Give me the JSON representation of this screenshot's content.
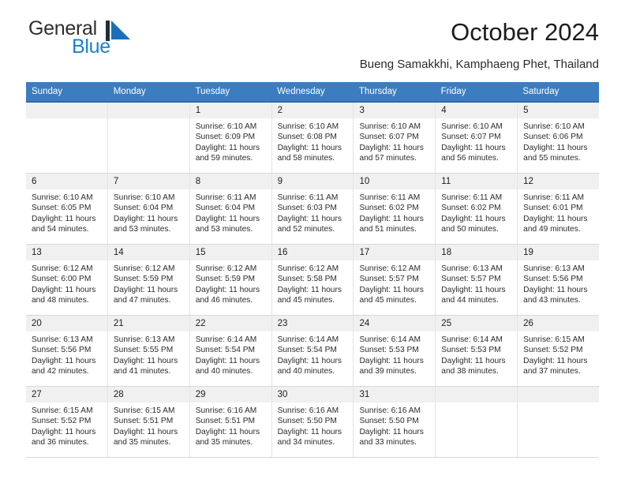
{
  "brand": {
    "name_dark": "General",
    "name_blue": "Blue",
    "mark": "triangle-logo",
    "color_dark": "#2e2e2e",
    "color_blue": "#1b80d4"
  },
  "header": {
    "title": "October 2024",
    "subtitle": "Bueng Samakkhi, Kamphaeng Phet, Thailand"
  },
  "theme": {
    "header_bg": "#3b7dc0",
    "header_text": "#ffffff",
    "daynum_bg": "#f0f0f0",
    "cell_bg": "#ffffff",
    "grid_line": "#e4e4e4"
  },
  "weekdays": [
    "Sunday",
    "Monday",
    "Tuesday",
    "Wednesday",
    "Thursday",
    "Friday",
    "Saturday"
  ],
  "weeks": [
    [
      {
        "date": "",
        "lines": []
      },
      {
        "date": "",
        "lines": []
      },
      {
        "date": "1",
        "lines": [
          "Sunrise: 6:10 AM",
          "Sunset: 6:09 PM",
          "Daylight: 11 hours",
          "and 59 minutes."
        ]
      },
      {
        "date": "2",
        "lines": [
          "Sunrise: 6:10 AM",
          "Sunset: 6:08 PM",
          "Daylight: 11 hours",
          "and 58 minutes."
        ]
      },
      {
        "date": "3",
        "lines": [
          "Sunrise: 6:10 AM",
          "Sunset: 6:07 PM",
          "Daylight: 11 hours",
          "and 57 minutes."
        ]
      },
      {
        "date": "4",
        "lines": [
          "Sunrise: 6:10 AM",
          "Sunset: 6:07 PM",
          "Daylight: 11 hours",
          "and 56 minutes."
        ]
      },
      {
        "date": "5",
        "lines": [
          "Sunrise: 6:10 AM",
          "Sunset: 6:06 PM",
          "Daylight: 11 hours",
          "and 55 minutes."
        ]
      }
    ],
    [
      {
        "date": "6",
        "lines": [
          "Sunrise: 6:10 AM",
          "Sunset: 6:05 PM",
          "Daylight: 11 hours",
          "and 54 minutes."
        ]
      },
      {
        "date": "7",
        "lines": [
          "Sunrise: 6:10 AM",
          "Sunset: 6:04 PM",
          "Daylight: 11 hours",
          "and 53 minutes."
        ]
      },
      {
        "date": "8",
        "lines": [
          "Sunrise: 6:11 AM",
          "Sunset: 6:04 PM",
          "Daylight: 11 hours",
          "and 53 minutes."
        ]
      },
      {
        "date": "9",
        "lines": [
          "Sunrise: 6:11 AM",
          "Sunset: 6:03 PM",
          "Daylight: 11 hours",
          "and 52 minutes."
        ]
      },
      {
        "date": "10",
        "lines": [
          "Sunrise: 6:11 AM",
          "Sunset: 6:02 PM",
          "Daylight: 11 hours",
          "and 51 minutes."
        ]
      },
      {
        "date": "11",
        "lines": [
          "Sunrise: 6:11 AM",
          "Sunset: 6:02 PM",
          "Daylight: 11 hours",
          "and 50 minutes."
        ]
      },
      {
        "date": "12",
        "lines": [
          "Sunrise: 6:11 AM",
          "Sunset: 6:01 PM",
          "Daylight: 11 hours",
          "and 49 minutes."
        ]
      }
    ],
    [
      {
        "date": "13",
        "lines": [
          "Sunrise: 6:12 AM",
          "Sunset: 6:00 PM",
          "Daylight: 11 hours",
          "and 48 minutes."
        ]
      },
      {
        "date": "14",
        "lines": [
          "Sunrise: 6:12 AM",
          "Sunset: 5:59 PM",
          "Daylight: 11 hours",
          "and 47 minutes."
        ]
      },
      {
        "date": "15",
        "lines": [
          "Sunrise: 6:12 AM",
          "Sunset: 5:59 PM",
          "Daylight: 11 hours",
          "and 46 minutes."
        ]
      },
      {
        "date": "16",
        "lines": [
          "Sunrise: 6:12 AM",
          "Sunset: 5:58 PM",
          "Daylight: 11 hours",
          "and 45 minutes."
        ]
      },
      {
        "date": "17",
        "lines": [
          "Sunrise: 6:12 AM",
          "Sunset: 5:57 PM",
          "Daylight: 11 hours",
          "and 45 minutes."
        ]
      },
      {
        "date": "18",
        "lines": [
          "Sunrise: 6:13 AM",
          "Sunset: 5:57 PM",
          "Daylight: 11 hours",
          "and 44 minutes."
        ]
      },
      {
        "date": "19",
        "lines": [
          "Sunrise: 6:13 AM",
          "Sunset: 5:56 PM",
          "Daylight: 11 hours",
          "and 43 minutes."
        ]
      }
    ],
    [
      {
        "date": "20",
        "lines": [
          "Sunrise: 6:13 AM",
          "Sunset: 5:56 PM",
          "Daylight: 11 hours",
          "and 42 minutes."
        ]
      },
      {
        "date": "21",
        "lines": [
          "Sunrise: 6:13 AM",
          "Sunset: 5:55 PM",
          "Daylight: 11 hours",
          "and 41 minutes."
        ]
      },
      {
        "date": "22",
        "lines": [
          "Sunrise: 6:14 AM",
          "Sunset: 5:54 PM",
          "Daylight: 11 hours",
          "and 40 minutes."
        ]
      },
      {
        "date": "23",
        "lines": [
          "Sunrise: 6:14 AM",
          "Sunset: 5:54 PM",
          "Daylight: 11 hours",
          "and 40 minutes."
        ]
      },
      {
        "date": "24",
        "lines": [
          "Sunrise: 6:14 AM",
          "Sunset: 5:53 PM",
          "Daylight: 11 hours",
          "and 39 minutes."
        ]
      },
      {
        "date": "25",
        "lines": [
          "Sunrise: 6:14 AM",
          "Sunset: 5:53 PM",
          "Daylight: 11 hours",
          "and 38 minutes."
        ]
      },
      {
        "date": "26",
        "lines": [
          "Sunrise: 6:15 AM",
          "Sunset: 5:52 PM",
          "Daylight: 11 hours",
          "and 37 minutes."
        ]
      }
    ],
    [
      {
        "date": "27",
        "lines": [
          "Sunrise: 6:15 AM",
          "Sunset: 5:52 PM",
          "Daylight: 11 hours",
          "and 36 minutes."
        ]
      },
      {
        "date": "28",
        "lines": [
          "Sunrise: 6:15 AM",
          "Sunset: 5:51 PM",
          "Daylight: 11 hours",
          "and 35 minutes."
        ]
      },
      {
        "date": "29",
        "lines": [
          "Sunrise: 6:16 AM",
          "Sunset: 5:51 PM",
          "Daylight: 11 hours",
          "and 35 minutes."
        ]
      },
      {
        "date": "30",
        "lines": [
          "Sunrise: 6:16 AM",
          "Sunset: 5:50 PM",
          "Daylight: 11 hours",
          "and 34 minutes."
        ]
      },
      {
        "date": "31",
        "lines": [
          "Sunrise: 6:16 AM",
          "Sunset: 5:50 PM",
          "Daylight: 11 hours",
          "and 33 minutes."
        ]
      },
      {
        "date": "",
        "lines": []
      },
      {
        "date": "",
        "lines": []
      }
    ]
  ]
}
